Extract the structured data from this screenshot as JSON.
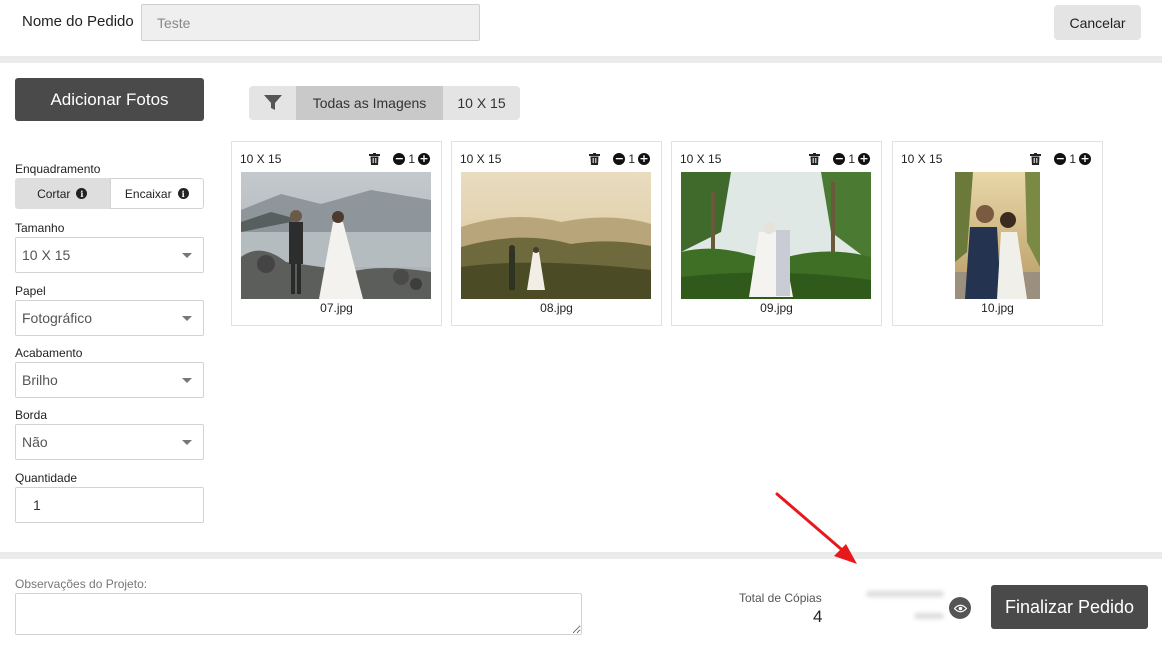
{
  "header": {
    "order_label": "Nome do Pedido",
    "order_value": "Teste",
    "cancel_label": "Cancelar"
  },
  "sidebar": {
    "add_photos_label": "Adicionar Fotos",
    "framing": {
      "label": "Enquadramento",
      "options": [
        "Cortar",
        "Encaixar"
      ],
      "selected": "Cortar"
    },
    "size": {
      "label": "Tamanho",
      "value": "10 X 15"
    },
    "paper": {
      "label": "Papel",
      "value": "Fotográfico"
    },
    "finish": {
      "label": "Acabamento",
      "value": "Brilho"
    },
    "border": {
      "label": "Borda",
      "value": "Não"
    },
    "quantity": {
      "label": "Quantidade",
      "value": "1"
    }
  },
  "filters": {
    "icon": "filter-icon",
    "all_label": "Todas as Imagens",
    "size_label": "10 X 15",
    "selected": "Todas as Imagens"
  },
  "photos": [
    {
      "size": "10 X 15",
      "qty": "1",
      "file": "07.jpg"
    },
    {
      "size": "10 X 15",
      "qty": "1",
      "file": "08.jpg"
    },
    {
      "size": "10 X 15",
      "qty": "1",
      "file": "09.jpg"
    },
    {
      "size": "10 X 15",
      "qty": "1",
      "file": "10.jpg"
    }
  ],
  "footer": {
    "notes_label": "Observações do Projeto:",
    "total_label": "Total de Cópias",
    "total_value": "4",
    "finalize_label": "Finalizar Pedido"
  },
  "colors": {
    "primary_button": "#4a4a4a",
    "annotation_arrow": "#e8191c"
  }
}
